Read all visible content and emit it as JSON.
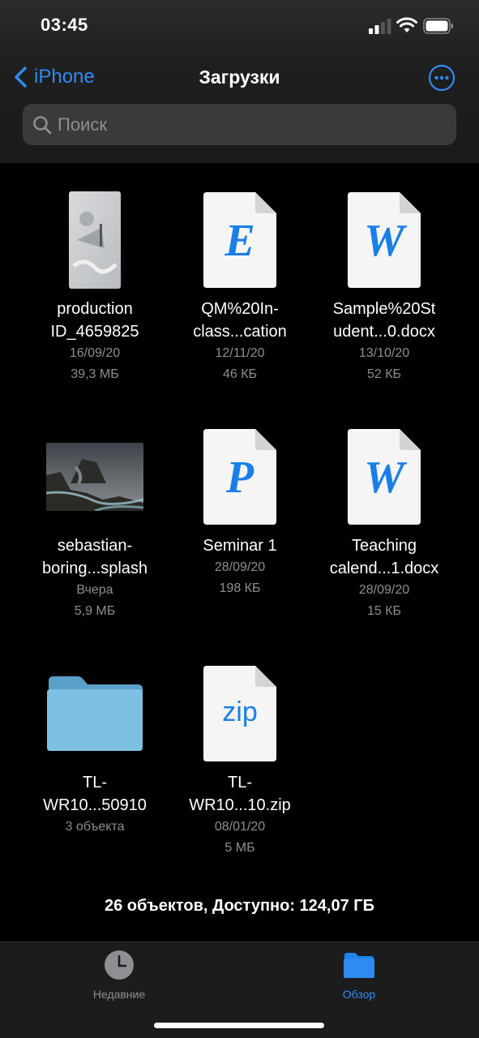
{
  "status": {
    "time": "03:45"
  },
  "nav": {
    "back_label": "iPhone",
    "title": "Загрузки"
  },
  "search": {
    "placeholder": "Поиск"
  },
  "files": [
    {
      "name_line1": "production",
      "name_line2": "ID_4659825",
      "date": "16/09/20",
      "size": "39,3 МБ",
      "icon": "video-thumbnail"
    },
    {
      "name_line1": "QM%20In-",
      "name_line2": "class...cation",
      "date": "12/11/20",
      "size": "46 КБ",
      "icon": "epub-document-icon",
      "letter": "E"
    },
    {
      "name_line1": "Sample%20St",
      "name_line2": "udent...0.docx",
      "date": "13/10/20",
      "size": "52 КБ",
      "icon": "word-document-icon",
      "letter": "W"
    },
    {
      "name_line1": "sebastian-",
      "name_line2": "boring...splash",
      "date": "Вчера",
      "size": "5,9 МБ",
      "icon": "photo-thumbnail"
    },
    {
      "name_line1": "Seminar 1",
      "name_line2": "",
      "date": "28/09/20",
      "size": "198 КБ",
      "icon": "pages-document-icon",
      "letter": "P"
    },
    {
      "name_line1": "Teaching",
      "name_line2": "calend...1.docx",
      "date": "28/09/20",
      "size": "15 КБ",
      "icon": "word-document-icon",
      "letter": "W"
    },
    {
      "name_line1": "TL-",
      "name_line2": "WR10...50910",
      "date": "3 объекта",
      "size": "",
      "icon": "folder-icon"
    },
    {
      "name_line1": "TL-",
      "name_line2": "WR10...10.zip",
      "date": "08/01/20",
      "size": "5 МБ",
      "icon": "zip-archive-icon",
      "letter": "zip"
    }
  ],
  "footer": {
    "summary": "26 объектов, Доступно: 124,07 ГБ"
  },
  "tabs": [
    {
      "label": "Недавние",
      "icon": "clock-icon",
      "active": false
    },
    {
      "label": "Обзор",
      "icon": "folder-icon",
      "active": true
    }
  ],
  "colors": {
    "accent": "#2f8bf1",
    "background": "#000000",
    "secondary_text": "#8e8e93"
  }
}
